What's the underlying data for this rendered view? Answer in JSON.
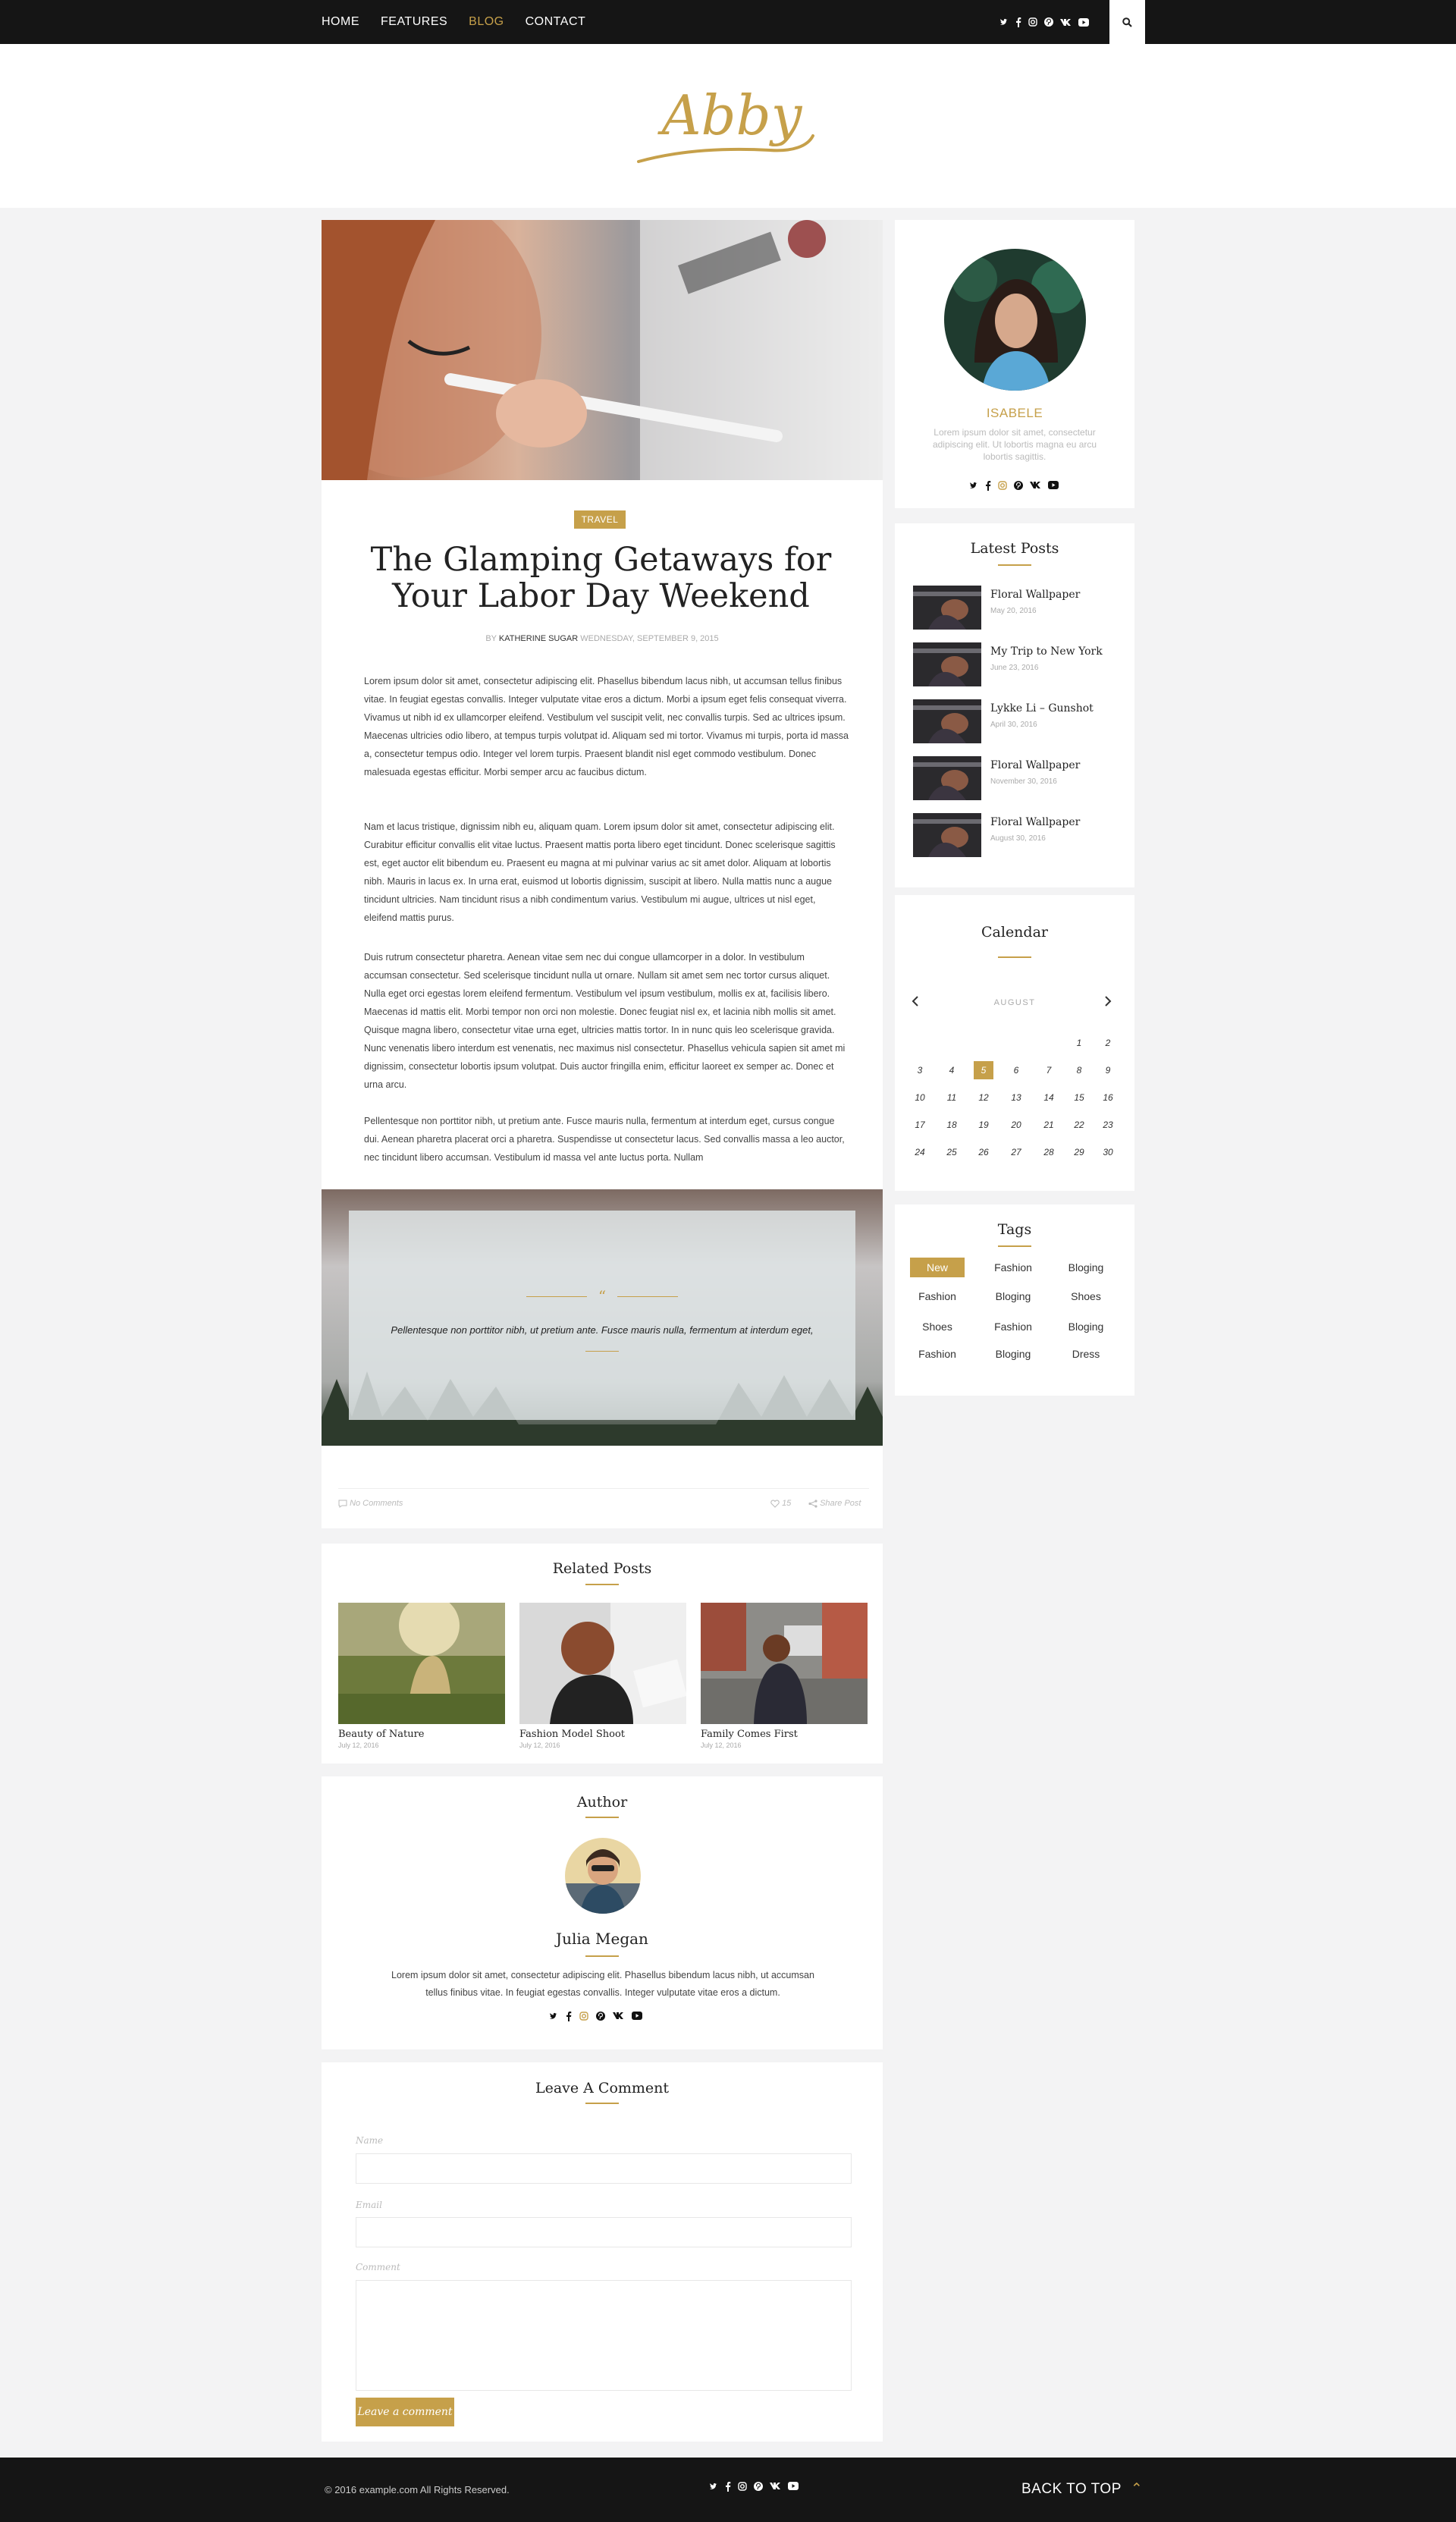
{
  "nav": {
    "items": [
      {
        "label": "HOME",
        "active": false
      },
      {
        "label": "FEATURES",
        "active": false
      },
      {
        "label": "BLOG",
        "active": true
      },
      {
        "label": "CONTACT",
        "active": false
      }
    ],
    "social_icons": [
      "twitter-icon",
      "facebook-icon",
      "instagram-icon",
      "pinterest-icon",
      "vk-icon",
      "youtube-icon"
    ],
    "search_icon": "search-icon"
  },
  "brand": {
    "logo_text": "Abby",
    "accent_color": "#c6a04a"
  },
  "article": {
    "category": "TRAVEL",
    "title": "The Glamping Getaways for Your Labor Day Weekend",
    "meta": {
      "by_label": "BY",
      "author": "KATHERINE SUGAR",
      "date": "WEDNESDAY, SEPTEMBER 9, 2015"
    },
    "paragraphs": [
      "Lorem ipsum dolor sit amet, consectetur adipiscing elit. Phasellus bibendum lacus nibh, ut accumsan tellus finibus vitae. In feugiat egestas convallis. Integer vulputate vitae eros a dictum. Morbi a ipsum eget felis consequat viverra. Vivamus ut nibh id ex ullamcorper eleifend. Vestibulum vel suscipit velit, nec convallis turpis. Sed ac ultrices ipsum. Maecenas ultricies odio libero, at tempus turpis volutpat id. Aliquam sed mi tortor. Vivamus mi turpis, porta id massa a, consectetur tempus odio. Integer vel lorem turpis. Praesent blandit nisl eget commodo vestibulum. Donec malesuada egestas efficitur. Morbi semper arcu ac faucibus dictum.",
      "Nam et lacus tristique, dignissim nibh eu, aliquam quam. Lorem ipsum dolor sit amet, consectetur adipiscing elit. Curabitur efficitur convallis elit vitae luctus. Praesent mattis porta libero eget tincidunt. Donec scelerisque sagittis est, eget auctor elit bibendum eu. Praesent eu magna at mi pulvinar varius ac sit amet dolor. Aliquam at lobortis nibh. Mauris in lacus ex. In urna erat, euismod ut lobortis dignissim, suscipit at libero. Nulla mattis nunc a augue tincidunt ultricies. Nam tincidunt risus a nibh condimentum varius. Vestibulum mi augue, ultrices ut nisl eget, eleifend mattis purus.",
      "Duis rutrum consectetur pharetra. Aenean vitae sem nec dui congue ullamcorper in a dolor. In vestibulum accumsan consectetur. Sed scelerisque tincidunt nulla ut ornare. Nullam sit amet sem nec tortor cursus aliquet. Nulla eget orci egestas lorem eleifend fermentum. Vestibulum vel ipsum vestibulum, mollis ex at, facilisis libero. Maecenas id mattis elit. Morbi tempor non orci non molestie. Donec feugiat nisl ex, et lacinia nibh mollis sit amet. Quisque magna libero, consectetur vitae urna eget, ultricies mattis tortor. In in nunc quis leo scelerisque gravida. Nunc venenatis libero interdum est venenatis, nec maximus nisl consectetur. Phasellus vehicula sapien sit amet mi dignissim, consectetur lobortis ipsum volutpat. Duis auctor fringilla enim, efficitur laoreet ex semper ac. Donec et urna arcu.",
      "Pellentesque non porttitor nibh, ut pretium ante. Fusce mauris nulla, fermentum at interdum eget, cursus congue dui. Aenean pharetra placerat orci a pharetra. Suspendisse ut consectetur lacus. Sed convallis massa a leo auctor, nec tincidunt libero accumsan. Vestibulum id massa vel ante luctus porta. Nullam"
    ],
    "quote": {
      "mark": "“",
      "text": "Pellentesque non porttitor nibh, ut pretium ante. Fusce mauris nulla, fermentum at interdum eget,"
    },
    "footer": {
      "comments": "No Comments",
      "likes": "15",
      "share": "Share Post"
    }
  },
  "related": {
    "heading": "Related Posts",
    "items": [
      {
        "title": "Beauty of Nature",
        "date": "July 12, 2016"
      },
      {
        "title": "Fashion Model Shoot",
        "date": "July 12, 2016"
      },
      {
        "title": "Family Comes First",
        "date": "July 12, 2016"
      }
    ]
  },
  "author_box": {
    "heading": "Author",
    "name": "Julia Megan",
    "bio": "Lorem ipsum dolor sit amet, consectetur adipiscing elit. Phasellus bibendum lacus nibh, ut accumsan tellus finibus vitae. In feugiat egestas convallis. Integer vulputate vitae eros a dictum."
  },
  "comment_form": {
    "heading": "Leave A Comment",
    "name_label": "Name",
    "email_label": "Email",
    "comment_label": "Comment",
    "submit": "Leave a comment"
  },
  "sidebar": {
    "profile": {
      "name": "ISABELE",
      "bio": "Lorem ipsum dolor sit amet, consectetur adipiscing elit. Ut lobortis magna eu arcu lobortis sagittis."
    },
    "latest": {
      "heading": "Latest Posts",
      "items": [
        {
          "title": "Floral Wallpaper",
          "date": "May 20, 2016"
        },
        {
          "title": "My Trip to New York",
          "date": "June 23, 2016"
        },
        {
          "title": "Lykke Li – Gunshot",
          "date": "April 30, 2016"
        },
        {
          "title": "Floral Wallpaper",
          "date": "November 30, 2016"
        },
        {
          "title": "Floral Wallpaper",
          "date": "August 30, 2016"
        }
      ]
    },
    "calendar": {
      "heading": "Calendar",
      "month": "AUGUST",
      "today": "5",
      "weeks": [
        [
          "",
          "",
          "",
          "",
          "",
          "1",
          "2"
        ],
        [
          "3",
          "4",
          "5",
          "6",
          "7",
          "8",
          "9"
        ],
        [
          "10",
          "11",
          "12",
          "13",
          "14",
          "15",
          "16"
        ],
        [
          "17",
          "18",
          "19",
          "20",
          "21",
          "22",
          "23"
        ],
        [
          "24",
          "25",
          "26",
          "27",
          "28",
          "29",
          "30"
        ]
      ]
    },
    "tags": {
      "heading": "Tags",
      "items": [
        "New",
        "Fashion",
        "Bloging",
        "Fashion",
        "Bloging",
        "Shoes",
        "Shoes",
        "Fashion",
        "Bloging",
        "Fashion",
        "Bloging",
        "Dress"
      ],
      "active": "New"
    }
  },
  "footer": {
    "copyright": "© 2016 example.com All Rights Reserved.",
    "back_to_top": "BACK TO TOP"
  }
}
